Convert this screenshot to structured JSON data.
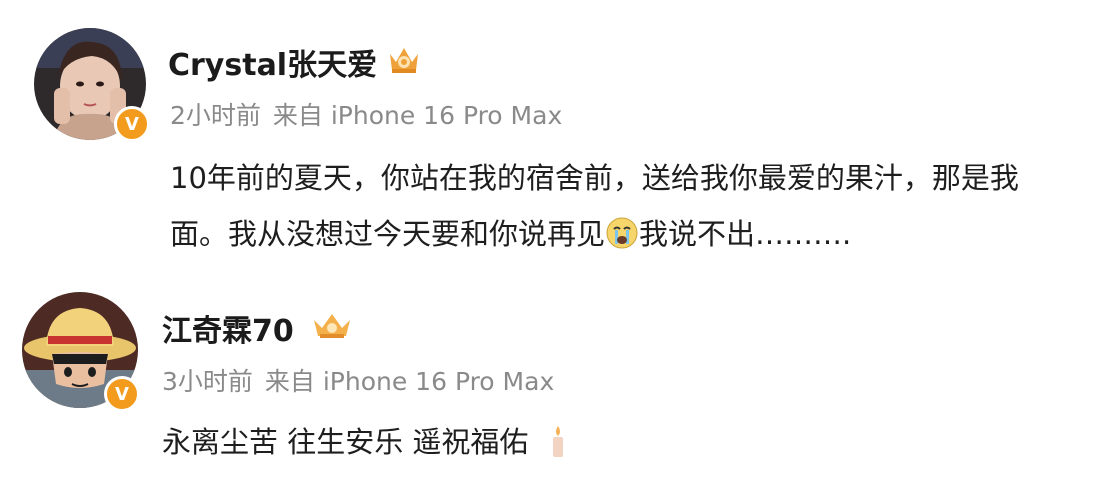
{
  "posts": [
    {
      "username": "Crystal张天爱",
      "time": "2小时前",
      "source": "来自 iPhone 16 Pro Max",
      "content_line1": "10年前的夏天，你站在我的宿舍前，送给我你最爱的果汁，那是我",
      "content_line2_before": "面。我从没想过今天要和你说再见",
      "content_line2_after": "我说不出……….",
      "verified_badge": "V",
      "icons": [
        "avatar-photo",
        "verified-badge-icon",
        "crown-icon",
        "crying-face-icon"
      ]
    },
    {
      "username": "江奇霖70",
      "time": "3小时前",
      "source": "来自 iPhone 16 Pro Max",
      "content": "永离尘苦 往生安乐 遥祝福佑",
      "verified_badge": "V",
      "icons": [
        "avatar-straw-hat",
        "verified-badge-icon",
        "crown-icon",
        "candle-icon"
      ]
    }
  ],
  "colors": {
    "verified": "#f29b1d",
    "meta": "#8a8a8a",
    "crown": "#f0a23a"
  }
}
